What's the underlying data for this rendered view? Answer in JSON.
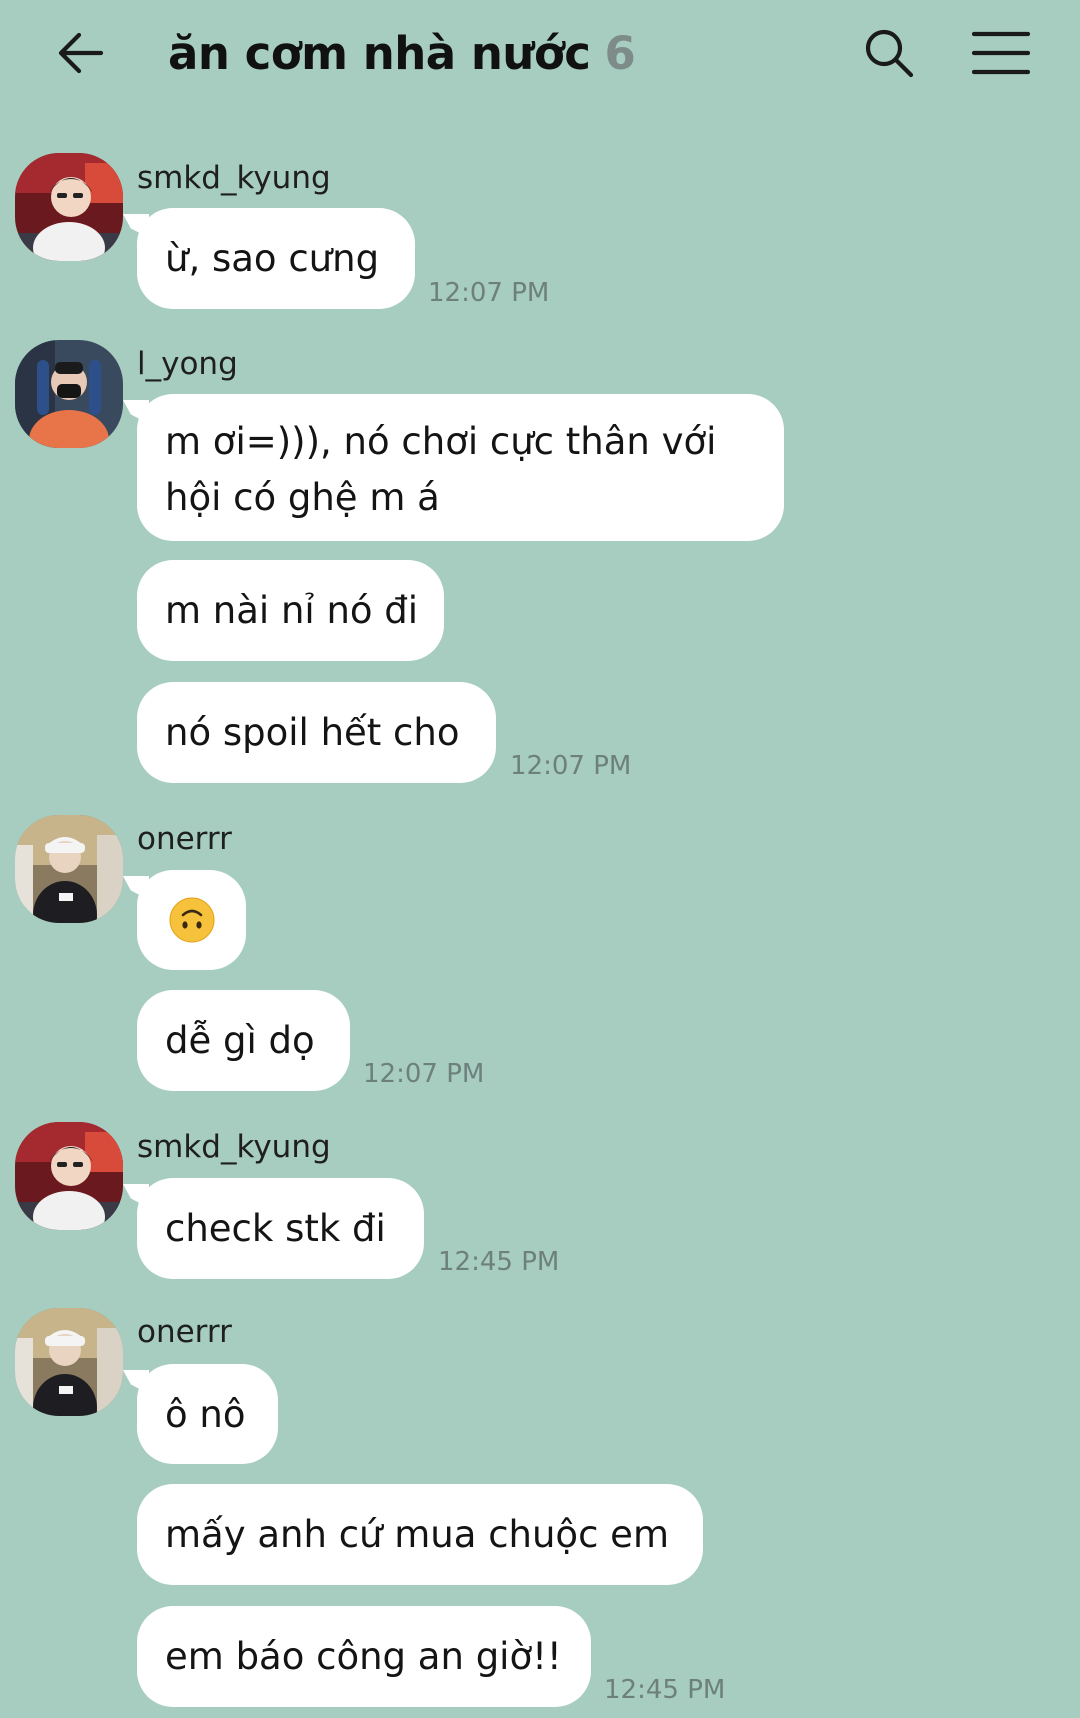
{
  "header": {
    "title": "ăn cơm nhà nước",
    "member_count": "6",
    "back_icon": "arrow-left-icon",
    "search_icon": "search-icon",
    "menu_icon": "hamburger-menu-icon"
  },
  "messages": [
    {
      "sender": "smkd_kyung",
      "lines": [
        "ừ, sao cưng"
      ],
      "time": "12:07 PM"
    },
    {
      "sender": "l_yong",
      "lines": [
        "m ơi=))), nó chơi cực thân với hội có ghệ m á",
        "m nài nỉ nó đi",
        "nó spoil hết cho"
      ],
      "time": "12:07 PM"
    },
    {
      "sender": "onerrr",
      "lines": [
        "upside-down-face-emoji",
        "dễ gì dọ"
      ],
      "time": "12:07 PM"
    },
    {
      "sender": "smkd_kyung",
      "lines": [
        "check stk đi"
      ],
      "time": "12:45 PM"
    },
    {
      "sender": "onerrr",
      "lines": [
        "ô nô",
        "mấy anh cứ mua chuộc em",
        "em báo công an giờ!!"
      ],
      "time": "12:45 PM"
    }
  ]
}
